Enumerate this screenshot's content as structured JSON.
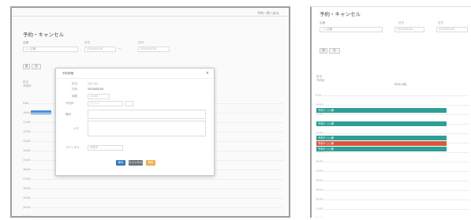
{
  "left": {
    "link": "予約一覧へ戻る",
    "title": "予約・キャンセル",
    "filters": [
      {
        "label": "店舗",
        "value": "○○店舗",
        "extra": ""
      },
      {
        "label": "日付",
        "value": "2024/05/20",
        "extra": "〜"
      },
      {
        "label": "日付",
        "value": "2024/05/25",
        "extra": ""
      }
    ],
    "pills": [
      "週",
      "日"
    ],
    "summary_lines": [
      "担当",
      "予約枠"
    ],
    "times": [
      "9:00",
      "10:00",
      "11:00",
      "12:00",
      "13:00",
      "14:00",
      "15:00",
      "16:00",
      "17:00",
      "18:00",
      "19:00",
      "20:00",
      "21:00"
    ],
    "modal": {
      "title": "予約詳細",
      "close": "×",
      "rows": [
        {
          "label": "担当",
          "value": "○○ ○○"
        },
        {
          "label": "日時",
          "value": "2024/05/20"
        },
        {
          "label": "時間",
          "value": "10:00"
        },
        {
          "label": "予約枠",
          "value": "○○○○"
        },
        {
          "label": "備考",
          "value": ""
        },
        {
          "label": "メモ",
          "value": ""
        },
        {
          "label": "ステータス",
          "value": "予約中"
        }
      ],
      "buttons": {
        "primary": "保存",
        "secondary": "キャンセル",
        "warning": "削除"
      },
      "colors": {
        "primary": "#337ab7",
        "secondary": "#6c757d",
        "warning": "#f0ad4e"
      }
    }
  },
  "right": {
    "title": "予約・キャンセル",
    "filters": [
      {
        "label": "店舗",
        "value": "○○店舗"
      },
      {
        "label": "日付",
        "value": "2024/05/20"
      },
      {
        "label": "日付",
        "value": "2024/05/25"
      }
    ],
    "pills": [
      "週",
      "日"
    ],
    "summary_lines": [
      "担当",
      "予約枠"
    ],
    "day_header": "5/20 (月)",
    "times": [
      "9:00",
      "10:00",
      "11:00",
      "12:00",
      "13:00",
      "14:00",
      "15:00",
      "16:00",
      "17:00",
      "18:00",
      "19:00",
      "20:00",
      "21:00",
      "22:00"
    ],
    "events": [
      {
        "label": "予約1 ○○様",
        "color": "#2e9e96"
      },
      {
        "label": "予約2 ○○様",
        "color": "#2e9e96"
      },
      {
        "label": "予約3 ○○様",
        "color": "#2e9e96"
      },
      {
        "label": "予約4 ○○様",
        "color": "#d9583b"
      },
      {
        "label": "予約5 ○○様",
        "color": "#2e9e96"
      }
    ]
  }
}
